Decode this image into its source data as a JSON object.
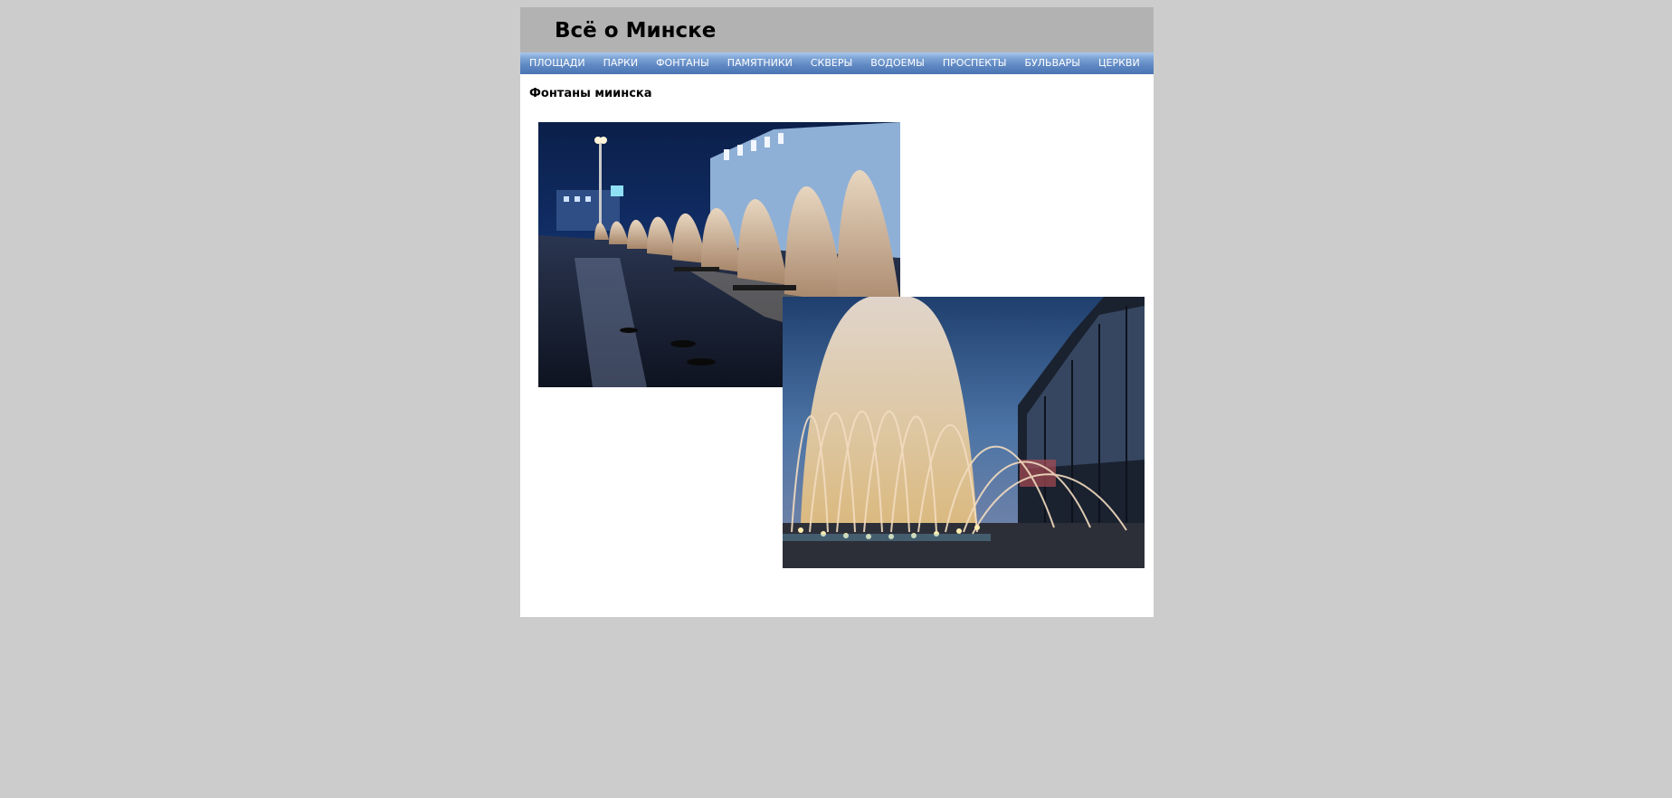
{
  "header": {
    "title": "Всё о Минске"
  },
  "nav": {
    "items": [
      {
        "label": "ПЛОЩАДИ"
      },
      {
        "label": "ПАРКИ"
      },
      {
        "label": "ФОНТАНЫ"
      },
      {
        "label": "ПАМЯТНИКИ"
      },
      {
        "label": "СКВЕРЫ"
      },
      {
        "label": "ВОДОЕМЫ"
      },
      {
        "label": "ПРОСПЕКТЫ"
      },
      {
        "label": "БУЛЬВАРЫ"
      },
      {
        "label": "ЦЕРКВИ"
      }
    ]
  },
  "main": {
    "heading": "Фонтаны миинска",
    "photos": [
      {
        "subject": "night-fountains-row"
      },
      {
        "subject": "illuminated-round-fountain"
      }
    ]
  },
  "colors": {
    "page_background": "#cccccc",
    "header_background": "#b2b2b2",
    "nav_background": "#5f88c3",
    "nav_text": "#ffffff",
    "content_background": "#ffffff"
  }
}
